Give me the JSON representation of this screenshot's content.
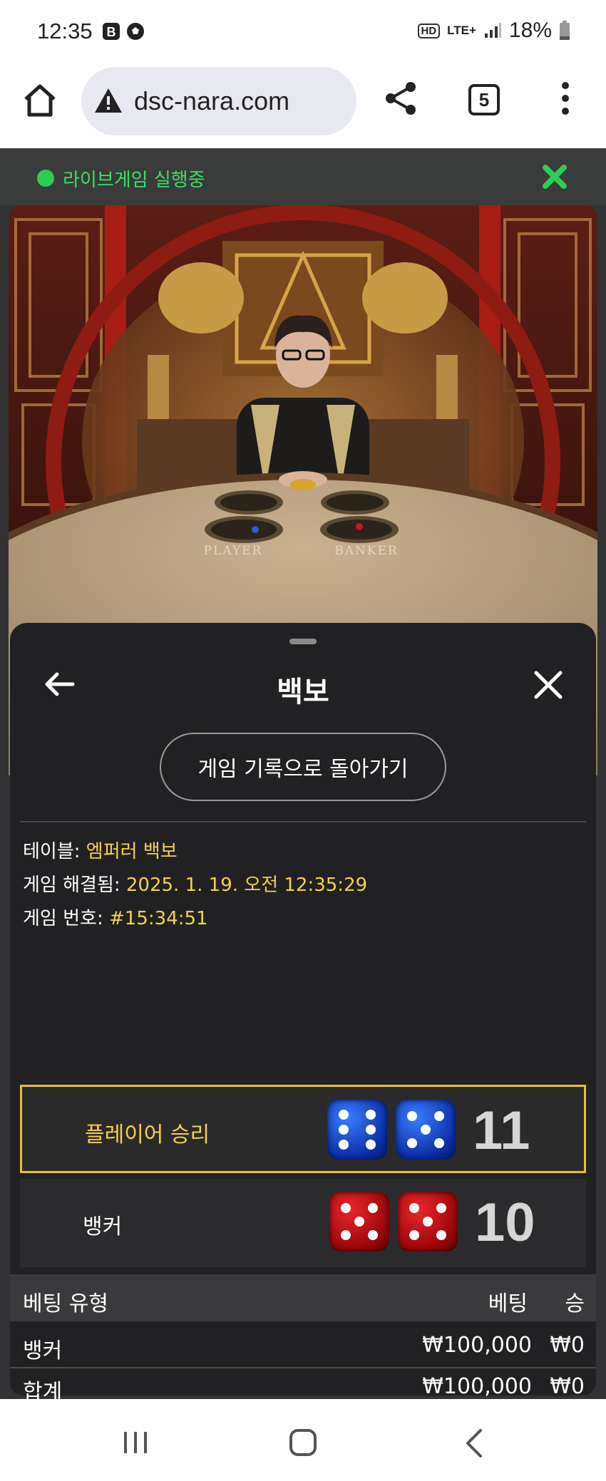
{
  "status_bar": {
    "time": "12:35",
    "hd": "HD",
    "network": "LTE+",
    "battery": "18%"
  },
  "browser": {
    "url": "dsc-nara.com",
    "tab_count": "5"
  },
  "live_bar": {
    "status_text": "라이브게임 실행중",
    "status_color": "#2ecc53"
  },
  "video": {
    "table_label_player": "PLAYER",
    "table_label_banker": "BANKER"
  },
  "sheet": {
    "title": "백보",
    "history_button": "게임 기록으로 돌아가기",
    "info": {
      "table_label": "테이블:",
      "table_value": "엠퍼러 백보",
      "resolved_label": "게임 해결됨:",
      "resolved_value": "2025. 1. 19. 오전 12:35:29",
      "number_label": "게임 번호:",
      "number_value": "#15:34:51"
    },
    "results": [
      {
        "label": "플레이어 승리",
        "dice": [
          6,
          5
        ],
        "score": "11",
        "color": "blue",
        "winner": true
      },
      {
        "label": "뱅커",
        "dice": [
          5,
          5
        ],
        "score": "10",
        "color": "red",
        "winner": false
      }
    ],
    "bets": {
      "headers": {
        "type": "베팅 유형",
        "bet": "베팅",
        "win": "승"
      },
      "rows": [
        {
          "type": "뱅커",
          "bet": "₩100,000",
          "win": "₩0"
        }
      ],
      "total": {
        "type": "합계",
        "bet": "₩100,000",
        "win": "₩0"
      }
    }
  },
  "colors": {
    "accent_gold": "#f5d24a",
    "win_border": "#e6c02a"
  }
}
